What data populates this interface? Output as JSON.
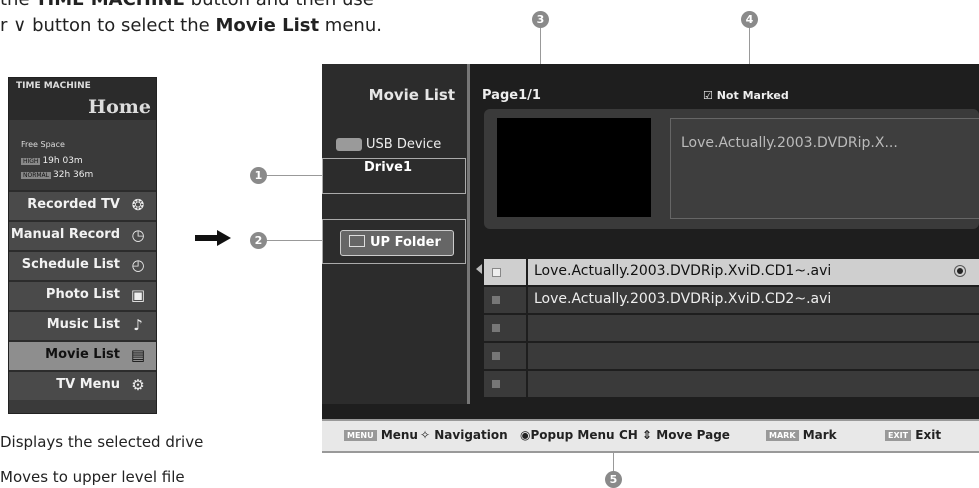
{
  "intro": {
    "line1_prefix": "the",
    "line1_bold": "TIME MACHINE",
    "line1_suffix": "button and then use",
    "line2_prefix": "r",
    "line2_symbol": "∨",
    "line2_middle": "button to select the",
    "line2_bold": "Movie List",
    "line2_suffix": "menu."
  },
  "tv_menu": {
    "header": "TIME MACHINE",
    "home": "Home",
    "free_space": "Free Space",
    "high_tag": "HIGH",
    "high_time": "19h 03m",
    "normal_tag": "NORMAL",
    "normal_time": "32h 36m",
    "items": [
      {
        "label": "Recorded TV",
        "icon": "film-reel-icon"
      },
      {
        "label": "Manual Record",
        "icon": "clock-record-icon"
      },
      {
        "label": "Schedule List",
        "icon": "calendar-clock-icon"
      },
      {
        "label": "Photo List",
        "icon": "photo-icon"
      },
      {
        "label": "Music List",
        "icon": "music-note-icon"
      },
      {
        "label": "Movie List",
        "icon": "movie-file-icon",
        "selected": true
      },
      {
        "label": "TV Menu",
        "icon": "gears-icon"
      }
    ]
  },
  "callouts": [
    "1",
    "2",
    "3",
    "4",
    "5"
  ],
  "screen": {
    "title": "Movie List",
    "usb_label": "USB Device",
    "drive": "Drive1",
    "up_folder": "UP Folder",
    "page": "Page1/1",
    "mark_status": "Not Marked",
    "preview_name": "Love.Actually.2003.DVDRip.X...",
    "files": [
      {
        "name": "Love.Actually.2003.DVDRip.XviD.CD1~.avi",
        "selected": true
      },
      {
        "name": "Love.Actually.2003.DVDRip.XviD.CD2~.avi"
      },
      {
        "name": ""
      },
      {
        "name": ""
      },
      {
        "name": ""
      }
    ]
  },
  "bottom_bar": {
    "menu_key": "MENU",
    "menu": "Menu",
    "navigation": "Navigation",
    "popup": "Popup Menu",
    "ch": "CH",
    "move_page": "Move Page",
    "mark_key": "MARK",
    "mark": "Mark",
    "exit_key": "EXIT",
    "exit": "Exit"
  },
  "definitions": [
    "Displays the selected drive",
    "Moves to upper level file"
  ],
  "colors": {
    "screen_bg": "#1e1e1e",
    "selected_row": "#cfcfcf",
    "callout": "#8a8a8a"
  }
}
